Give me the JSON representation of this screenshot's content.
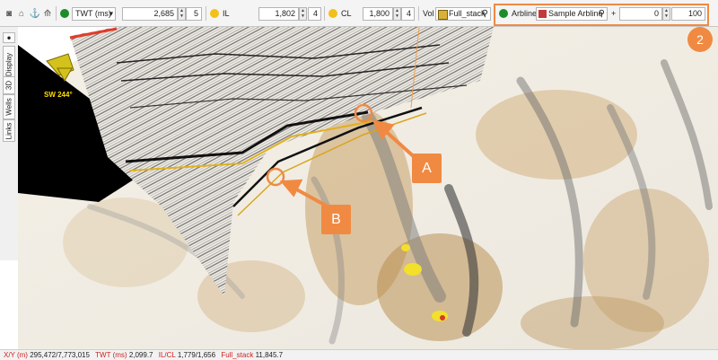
{
  "toolbar": {
    "domain": {
      "label": "TWT (ms)",
      "value": "2,685",
      "step": "5"
    },
    "il": {
      "label": "IL",
      "value": "1,802",
      "step": "4"
    },
    "cl": {
      "label": "CL",
      "value": "1,800",
      "step": "4"
    },
    "volume": {
      "label": "Vol",
      "value": "Full_stack"
    },
    "arbline": {
      "label": "Arbline",
      "value": "Sample Arbline",
      "plus": "+",
      "offset": "0",
      "width": "100"
    }
  },
  "sidebar": {
    "tabs": [
      "Display",
      "3D",
      "Wells",
      "Links"
    ]
  },
  "viewport": {
    "azimuth_label": "SW 244°"
  },
  "annotations": {
    "highlight_badge": "2",
    "callout_a": "A",
    "callout_b": "B"
  },
  "statusbar": {
    "xy_label": "X/Y (m)",
    "xy_value": "295,472/7,773,015",
    "twt_label": "TWT (ms)",
    "twt_value": "2,099.7",
    "ilcl_label": "IL/CL",
    "ilcl_value": "1,779/1,656",
    "vol_label": "Full_stack",
    "vol_value": "11,845.7"
  },
  "colors": {
    "accent": "#f08a43",
    "green_dot": "#1e8c2a",
    "yellow_dot": "#f2c01a",
    "status_key": "#cc2222"
  }
}
